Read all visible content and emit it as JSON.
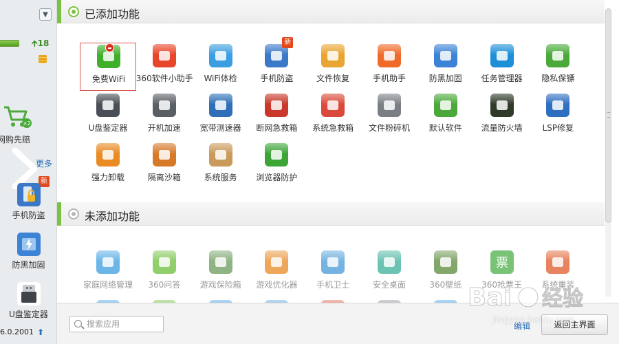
{
  "sidebar": {
    "collapse_icon": "chevron-down-icon",
    "points": "18",
    "shopping": {
      "label": "网购先赔",
      "badge": "×2"
    },
    "more_link": "更多",
    "new_badge": "新",
    "items": [
      {
        "label": "手机防盗",
        "icon": "phone-lock-icon"
      },
      {
        "label": "防黑加固",
        "icon": "shield-lightning-icon"
      },
      {
        "label": "U盘鉴定器",
        "icon": "usb-drive-icon"
      }
    ],
    "version": "6.0.2001"
  },
  "added_section": {
    "title": "已添加功能",
    "tiles": [
      {
        "label": "免费WiFi",
        "icon": "wifi-router-icon",
        "color": "#3fae2a",
        "selected": true,
        "removable": true
      },
      {
        "label": "360软件小助手",
        "icon": "colorful-blocks-icon",
        "color": "#e8462a"
      },
      {
        "label": "WiFi体检",
        "icon": "wifi-shield-icon",
        "color": "#3b9ee0"
      },
      {
        "label": "手机防盗",
        "icon": "phone-lock-icon",
        "color": "#3c78c8",
        "badge": "新"
      },
      {
        "label": "文件恢复",
        "icon": "folder-restore-icon",
        "color": "#e9a531"
      },
      {
        "label": "手机助手",
        "icon": "phone-assistant-icon",
        "color": "#f06a2a"
      },
      {
        "label": "防黑加固",
        "icon": "shield-lightning-icon",
        "color": "#3c83d6"
      },
      {
        "label": "任务管理器",
        "icon": "task-manager-icon",
        "color": "#1d8fd8"
      },
      {
        "label": "隐私保镖",
        "icon": "privacy-guard-icon",
        "color": "#4aa93a"
      },
      {
        "label": "U盘鉴定器",
        "icon": "usb-drive-icon",
        "color": "#4a4f57"
      },
      {
        "label": "开机加速",
        "icon": "boot-speed-icon",
        "color": "#5a5f66"
      },
      {
        "label": "宽带测速器",
        "icon": "speedometer-icon",
        "color": "#2e6fb8"
      },
      {
        "label": "断网急救箱",
        "icon": "network-firstaid-icon",
        "color": "#c9382a"
      },
      {
        "label": "系统急救箱",
        "icon": "system-firstaid-icon",
        "color": "#d94a3a"
      },
      {
        "label": "文件粉碎机",
        "icon": "shredder-icon",
        "color": "#7a7f86"
      },
      {
        "label": "默认软件",
        "icon": "default-software-icon",
        "color": "#4aa93a"
      },
      {
        "label": "流量防火墙",
        "icon": "traffic-firewall-icon",
        "color": "#2f3a2a"
      },
      {
        "label": "LSP修复",
        "icon": "lsp-repair-icon",
        "color": "#2e6fc0"
      },
      {
        "label": "强力卸载",
        "icon": "force-uninstall-icon",
        "color": "#e98a23"
      },
      {
        "label": "隔离沙箱",
        "icon": "sandbox-icon",
        "color": "#d67a2a"
      },
      {
        "label": "系统服务",
        "icon": "system-service-icon",
        "color": "#c99a5a"
      },
      {
        "label": "浏览器防护",
        "icon": "browser-protect-icon",
        "color": "#3da537"
      }
    ]
  },
  "not_added_section": {
    "title": "未添加功能",
    "tiles": [
      {
        "label": "家庭网络管理",
        "icon": "home-network-icon",
        "color": "#3b9ee0"
      },
      {
        "label": "360问答",
        "icon": "qa-bubble-icon",
        "color": "#6cbf3a"
      },
      {
        "label": "游戏保险箱",
        "icon": "game-safe-icon",
        "color": "#6a9a5a"
      },
      {
        "label": "游戏优化器",
        "icon": "game-optimizer-icon",
        "color": "#e98a23"
      },
      {
        "label": "手机卫士",
        "icon": "mobile-guard-icon",
        "color": "#4a9ad8"
      },
      {
        "label": "安全桌面",
        "icon": "safe-desktop-icon",
        "color": "#3bb09a"
      },
      {
        "label": "360壁纸",
        "icon": "wallpaper-icon",
        "color": "#5a8a3a"
      },
      {
        "label": "360抢票王",
        "icon": "ticket-icon",
        "color": "#4db04a",
        "glyph": "票"
      },
      {
        "label": "系统重装",
        "icon": "system-reinstall-icon",
        "color": "#e05a2a"
      }
    ],
    "partial_row_icons": [
      "#3b9ee0",
      "#6cbf3a",
      "#4a9ad8",
      "#5aa0d8",
      "#e05a4a",
      "#8a8f96",
      "#3b9ee0"
    ]
  },
  "bottom_bar": {
    "search_placeholder": "搜索应用",
    "edit_link": "编辑",
    "return_button": "返回主界面"
  },
  "watermark": {
    "url": "jingyan.baidu.com"
  }
}
